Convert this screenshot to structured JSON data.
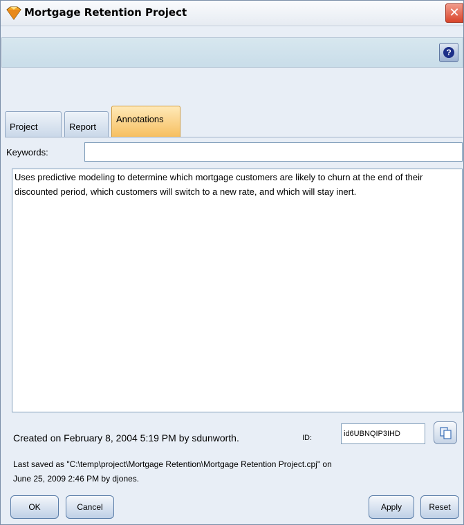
{
  "window": {
    "title": "Mortgage Retention Project",
    "close_label": "✕",
    "help_label": "?"
  },
  "tabs": [
    {
      "label": "Project",
      "active": false
    },
    {
      "label": "Report",
      "active": false
    },
    {
      "label": "Annotations",
      "active": true
    }
  ],
  "annotations": {
    "keywords_label": "Keywords:",
    "keywords_value": "",
    "text": "Uses predictive modeling to determine which mortgage customers are likely to churn at the end of their discounted period, which customers will switch to a new rate, and which will stay inert.",
    "created": "Created on February 8, 2004 5:19 PM by sdunworth.",
    "id_label": "ID:",
    "id_value": "id6UBNQIP3IHD",
    "saved_line1": "Last saved as \"C:\\temp\\project\\Mortgage Retention\\Mortgage Retention Project.cpj\" on",
    "saved_line2": "June 25, 2009 2:46 PM by djones."
  },
  "buttons": {
    "ok": "OK",
    "cancel": "Cancel",
    "apply": "Apply",
    "reset": "Reset"
  },
  "icons": {
    "title": "project-gem-icon",
    "close": "close-icon",
    "help": "help-icon",
    "copy": "copy-icon"
  },
  "colors": {
    "active_tab": "#f6be5e",
    "close": "#d9452b",
    "help_circle": "#1d2f88"
  }
}
